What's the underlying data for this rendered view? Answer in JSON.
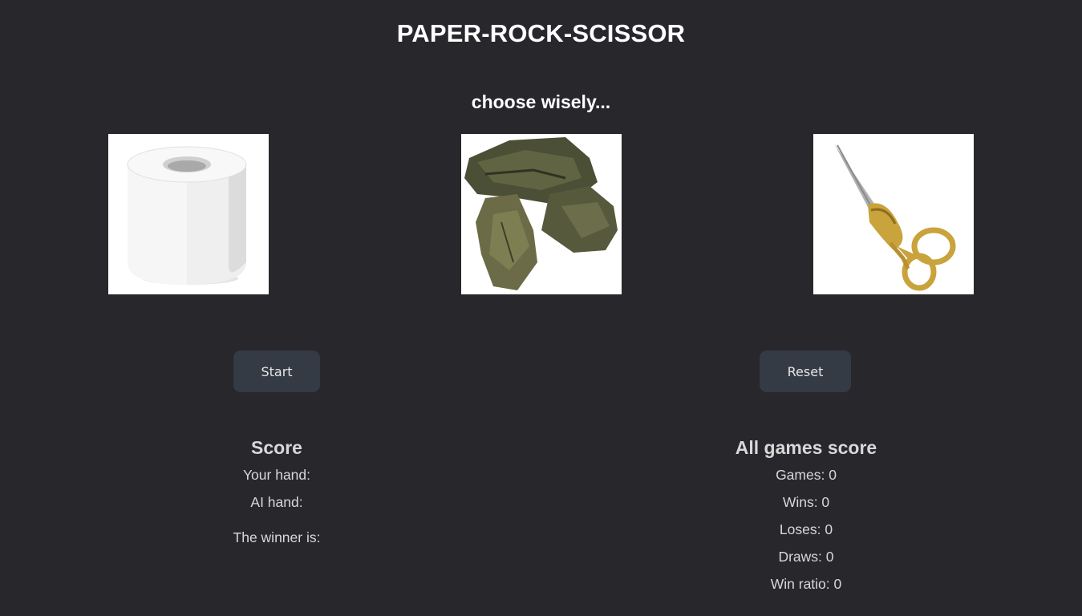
{
  "header": {
    "title": "PAPER-ROCK-SCISSOR",
    "subtitle": "choose wisely..."
  },
  "choices": [
    {
      "name": "paper",
      "icon": "toilet-paper-roll-image"
    },
    {
      "name": "rock",
      "icon": "rock-image"
    },
    {
      "name": "scissor",
      "icon": "scissors-image"
    }
  ],
  "controls": {
    "start_label": "Start",
    "reset_label": "Reset"
  },
  "score": {
    "heading": "Score",
    "your_hand": "Your hand:",
    "ai_hand": "AI hand:",
    "winner": "The winner is:"
  },
  "all_games": {
    "heading": "All games score",
    "games": "Games: 0",
    "wins": "Wins: 0",
    "loses": "Loses: 0",
    "draws": "Draws: 0",
    "win_ratio": "Win ratio: 0"
  },
  "colors": {
    "background": "#28272c",
    "button": "#353b45",
    "text": "#ffffff",
    "muted_text": "#d8d8d8"
  }
}
